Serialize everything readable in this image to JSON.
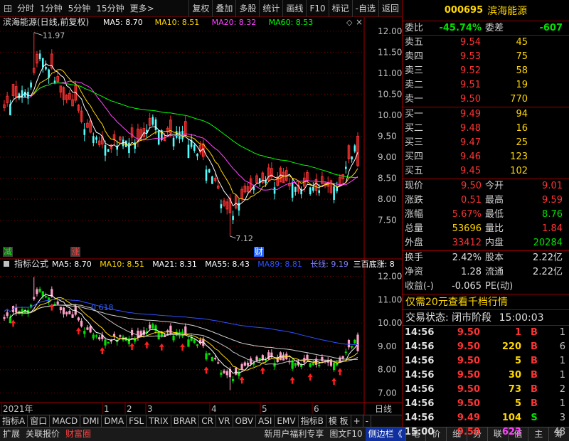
{
  "toolbar": {
    "left": [
      "分时",
      "1分钟",
      "5分钟",
      "15分钟",
      "更多>"
    ],
    "right": [
      "复权",
      "叠加",
      "多股",
      "统计",
      "画线",
      "F10",
      "标记",
      "-自选",
      "返回"
    ]
  },
  "main_chart": {
    "title": "滨海能源(日线,前复权)",
    "ma_labels": [
      {
        "text": "MA5: 8.70",
        "color": "#ffffff"
      },
      {
        "text": "MA10: 8.51",
        "color": "#ffd700"
      },
      {
        "text": "MA20: 8.32",
        "color": "#ff44ff"
      },
      {
        "text": "MA60: 8.53",
        "color": "#00ff00"
      }
    ],
    "high_label": "11.97",
    "low_label": "7.12",
    "y_ticks": [
      "12.00",
      "11.50",
      "11.00",
      "10.50",
      "10.00",
      "9.50",
      "9.00",
      "8.50",
      "8.00",
      "7.50"
    ],
    "marker_down": "减",
    "marker_up": "涨",
    "marker_cai": "财"
  },
  "sub_chart": {
    "title": "指标公式",
    "ma_labels": [
      {
        "text": "MA5: 8.70",
        "color": "#ffffff"
      },
      {
        "text": "MA10: 8.51",
        "color": "#ffd700"
      },
      {
        "text": "MA21: 8.31",
        "color": "#ffffff"
      },
      {
        "text": "MA55: 8.43",
        "color": "#ffffff"
      },
      {
        "text": "MA89: 8.81",
        "color": "#3050ff"
      },
      {
        "text": "长线: 9.19",
        "color": "#8080ff"
      },
      {
        "text": "三百底涨: 8",
        "color": "#ffffff"
      }
    ],
    "y_ticks": [
      "12.00",
      "11.00",
      "10.00",
      "9.00",
      "8.00",
      "7.00"
    ],
    "anno_value": "0.618"
  },
  "x_axis": {
    "labels": [
      "2021年",
      "1",
      "2",
      "3",
      "4",
      "5",
      "6"
    ],
    "right_label": "日线"
  },
  "bottom_tabs": [
    "指标A",
    "窗口",
    "MACD",
    "DMI",
    "DMA",
    "FSL",
    "TRIX",
    "BRAR",
    "CR",
    "VR",
    "OBV",
    "ASI",
    "EMV",
    "指标B",
    "模 板",
    "+",
    "-"
  ],
  "status_bar": {
    "items": [
      "扩展",
      "关联报价",
      "财富圈"
    ],
    "mid": [
      "新用户福利专享",
      "图文F10",
      "侧边栏《"
    ],
    "quick": [
      "笔",
      "价",
      "细",
      "势",
      "联",
      "值",
      "主",
      "筹"
    ]
  },
  "quote": {
    "code": "000695",
    "name": "滨海能源",
    "weibi_label": "委比",
    "weibi": "-45.74%",
    "weicha_label": "委差",
    "weicha": "-607",
    "asks": [
      {
        "label": "卖五",
        "price": "9.54",
        "vol": "45"
      },
      {
        "label": "卖四",
        "price": "9.53",
        "vol": "75"
      },
      {
        "label": "卖三",
        "price": "9.52",
        "vol": "58"
      },
      {
        "label": "卖二",
        "price": "9.51",
        "vol": "19"
      },
      {
        "label": "卖一",
        "price": "9.50",
        "vol": "770"
      }
    ],
    "bids": [
      {
        "label": "买一",
        "price": "9.49",
        "vol": "94"
      },
      {
        "label": "买二",
        "price": "9.48",
        "vol": "16"
      },
      {
        "label": "买三",
        "price": "9.47",
        "vol": "25"
      },
      {
        "label": "买四",
        "price": "9.46",
        "vol": "123"
      },
      {
        "label": "买五",
        "price": "9.45",
        "vol": "102"
      }
    ],
    "stats": [
      {
        "k1": "现价",
        "v1": "9.50",
        "c1": "red",
        "k2": "今开",
        "v2": "9.01",
        "c2": "red"
      },
      {
        "k1": "涨跌",
        "v1": "0.51",
        "c1": "red",
        "k2": "最高",
        "v2": "9.59",
        "c2": "red"
      },
      {
        "k1": "涨幅",
        "v1": "5.67%",
        "c1": "red",
        "k2": "最低",
        "v2": "8.76",
        "c2": "green"
      },
      {
        "k1": "总量",
        "v1": "53696",
        "c1": "yel",
        "k2": "量比",
        "v2": "1.84",
        "c2": "red"
      },
      {
        "k1": "外盘",
        "v1": "33412",
        "c1": "red",
        "k2": "内盘",
        "v2": "20284",
        "c2": "green"
      }
    ],
    "fund": [
      {
        "k1": "换手",
        "v1": "2.42%",
        "k2": "股本",
        "v2": "2.22亿"
      },
      {
        "k1": "净资",
        "v1": "1.28",
        "k2": "流通",
        "v2": "2.22亿"
      },
      {
        "k1": "收益(-)",
        "v1": "-0.065",
        "k2": "PE(动)",
        "v2": ""
      }
    ],
    "promo": "仅需20元查看千档行情",
    "status_label": "交易状态:",
    "status_value": "闭市阶段",
    "status_time": "15:00:03",
    "ticks": [
      {
        "time": "14:56",
        "price": "9.50",
        "pc": "red",
        "vol": "1",
        "vc": "red",
        "side": "B",
        "sc": "red",
        "n": "1"
      },
      {
        "time": "14:56",
        "price": "9.50",
        "pc": "red",
        "vol": "220",
        "vc": "yel",
        "side": "B",
        "sc": "red",
        "n": "6"
      },
      {
        "time": "14:56",
        "price": "9.50",
        "pc": "red",
        "vol": "5",
        "vc": "yel",
        "side": "B",
        "sc": "red",
        "n": "1"
      },
      {
        "time": "14:56",
        "price": "9.50",
        "pc": "red",
        "vol": "30",
        "vc": "yel",
        "side": "B",
        "sc": "red",
        "n": "1"
      },
      {
        "time": "14:56",
        "price": "9.50",
        "pc": "red",
        "vol": "73",
        "vc": "yel",
        "side": "B",
        "sc": "red",
        "n": "2"
      },
      {
        "time": "14:56",
        "price": "9.50",
        "pc": "red",
        "vol": "5",
        "vc": "yel",
        "side": "B",
        "sc": "red",
        "n": "1"
      },
      {
        "time": "14:56",
        "price": "9.49",
        "pc": "red",
        "vol": "104",
        "vc": "yel",
        "side": "S",
        "sc": "green",
        "n": "3"
      },
      {
        "time": "15:00",
        "price": "9.50",
        "pc": "red",
        "vol": "623",
        "vc": "mag",
        "side": "",
        "sc": "red",
        "n": "48"
      }
    ]
  },
  "colors": {
    "up": "#ff3232",
    "down": "#54ffff",
    "grid": "#800000",
    "axis_text": "#c0c0c0"
  }
}
